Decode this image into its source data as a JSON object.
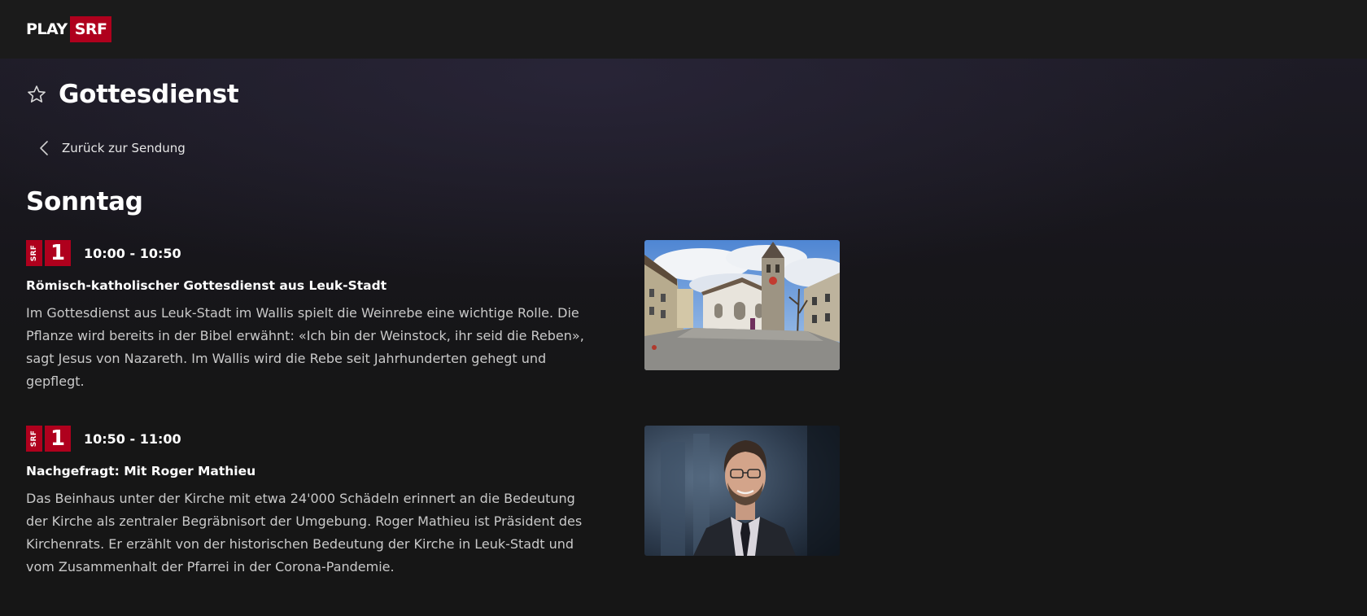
{
  "header": {
    "logo_play": "PLAY",
    "logo_srf": "SRF"
  },
  "page": {
    "title": "Gottesdienst",
    "back_label": "Zurück zur Sendung",
    "day_heading": "Sonntag"
  },
  "programs": [
    {
      "channel_srf": "SRF",
      "channel_number": "1",
      "time": "10:00 - 10:50",
      "title": "Römisch-katholischer Gottesdienst aus Leuk-Stadt",
      "description": "Im Gottesdienst aus Leuk-Stadt im Wallis spielt die Weinrebe eine wichtige Rolle. Die Pflanze wird bereits in der Bibel erwähnt: «Ich bin der Weinstock, ihr seid die Reben», sagt Jesus von Nazareth. Im Wallis wird die Rebe seit Jahrhunderten gehegt und gepflegt."
    },
    {
      "channel_srf": "SRF",
      "channel_number": "1",
      "time": "10:50 - 11:00",
      "title": "Nachgefragt: Mit Roger Mathieu",
      "description": "Das Beinhaus unter der Kirche mit etwa 24'000 Schädeln erinnert an die Bedeutung der Kirche als zentraler Begräbnisort der Umgebung. Roger Mathieu ist Präsident des Kirchenrats. Er erzählt von der historischen Bedeutung der Kirche in Leuk-Stadt und vom Zusammenhalt der Pfarrei in der Corona-Pandemie."
    }
  ],
  "colors": {
    "brand_red": "#af001d",
    "background": "#161616",
    "text_secondary": "#c9c9c9"
  },
  "icons": {
    "favorite": "star-outline-icon",
    "back": "chevron-left-icon"
  }
}
